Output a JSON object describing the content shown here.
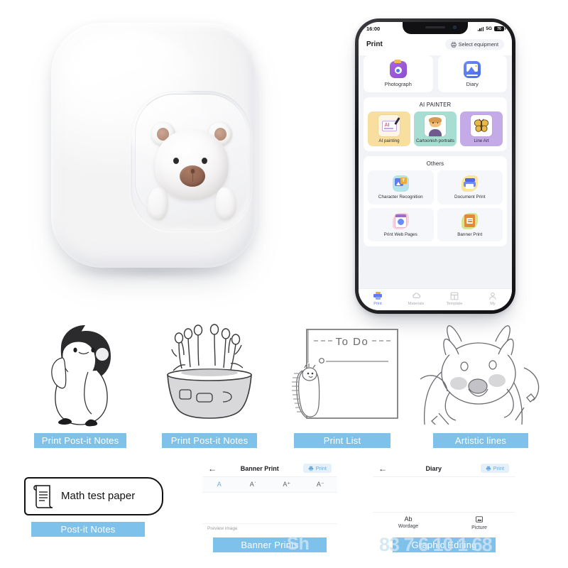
{
  "product": {
    "device_name": "mini-pocket-printer",
    "body_color": "#f5f5f6",
    "mascot": "bear"
  },
  "phone": {
    "status_bar": {
      "time": "16:00",
      "network": "5G",
      "battery": "70"
    },
    "header": {
      "title": "Print",
      "select_equipment": "Select equipment",
      "printer_icon": "printer-icon"
    },
    "top_cards": [
      {
        "label": "Photograph",
        "icon": "camera-icon",
        "color": "#9b5fd6"
      },
      {
        "label": "Diary",
        "icon": "image-icon",
        "color": "#5b7cf5"
      }
    ],
    "ai_painter": {
      "title": "AI PAINTER",
      "items": [
        {
          "label": "AI painting",
          "icon": "ai-monitor-icon",
          "color": "#f7dd9a"
        },
        {
          "label": "Cartoonish portraits",
          "icon": "portrait-icon",
          "color": "#a8ded2"
        },
        {
          "label": "Line Art",
          "icon": "butterfly-icon",
          "color": "#c4abe8"
        }
      ]
    },
    "others": {
      "title": "Others",
      "items": [
        {
          "label": "Character Recognition",
          "icon": "ocr-icon",
          "color": "#aee0e6"
        },
        {
          "label": "Document Print",
          "icon": "document-printer-icon",
          "color": "#f6e08a"
        },
        {
          "label": "Print Web Pages",
          "icon": "web-page-icon",
          "color": "#f3cfdb"
        },
        {
          "label": "Banner Print",
          "icon": "banner-icon",
          "color": "#cfe08a"
        }
      ]
    },
    "tab_bar": [
      {
        "label": "Print",
        "icon": "printer-icon",
        "active": true
      },
      {
        "label": "Materials",
        "icon": "cloud-icon",
        "active": false
      },
      {
        "label": "Template",
        "icon": "layout-icon",
        "active": false
      },
      {
        "label": "My",
        "icon": "user-icon",
        "active": false
      }
    ]
  },
  "samples": [
    {
      "caption": "Print Post-it Notes",
      "art": "penguin"
    },
    {
      "caption": "Print Post-it Notes",
      "art": "plant-pot"
    },
    {
      "caption": "Print List",
      "art": "to-do-list"
    },
    {
      "caption": "Artistic lines",
      "art": "shiba-dog"
    }
  ],
  "todo_art": {
    "heading": "To Do"
  },
  "math_chip": {
    "text": "Math test paper",
    "icon": "scroll-document-icon",
    "caption": "Post-it Notes"
  },
  "banner_panel": {
    "title": "Banner Print",
    "back_icon": "back-arrow-icon",
    "print_label": "Print",
    "format_buttons": [
      "A",
      "Aˈ",
      "A⁺",
      "A⁻"
    ],
    "preview_label": "Preview image",
    "caption": "Banner Prints"
  },
  "diary_panel": {
    "title": "Diary",
    "back_icon": "back-arrow-icon",
    "print_label": "Print",
    "tools": [
      {
        "label": "Wordage",
        "icon": "Ab"
      },
      {
        "label": "Picture",
        "icon": "picture-icon"
      }
    ],
    "caption": "Graphic Editing"
  },
  "watermarks": {
    "center": "Sh",
    "right": "83 7 6 10 1 68"
  },
  "colors": {
    "caption_bg": "#7ec1ea",
    "accent": "#5b7cf5",
    "print_btn": "#6ba9dd"
  }
}
